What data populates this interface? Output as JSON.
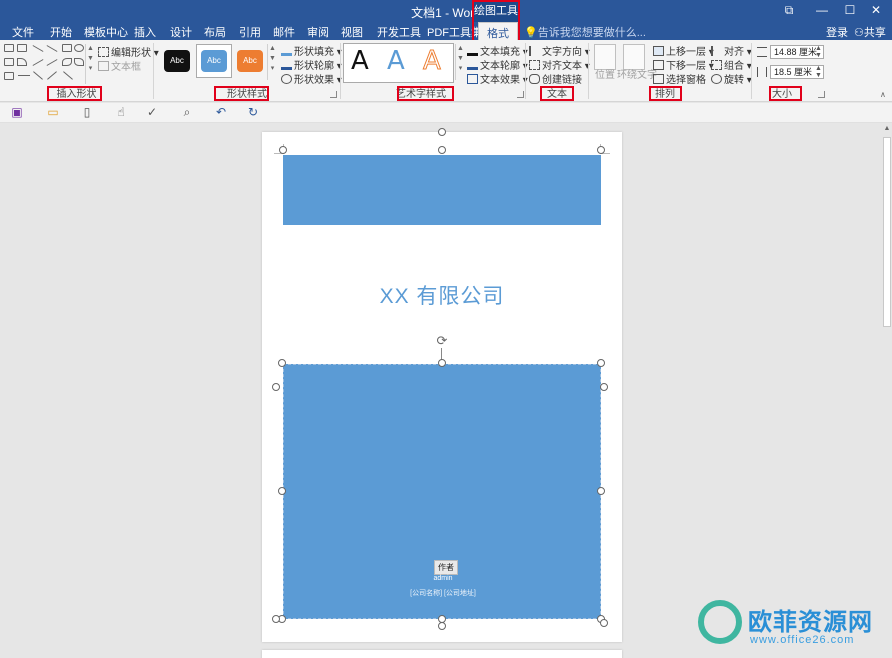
{
  "titlebar": {
    "title": "文档1 - Word",
    "context_label": "绘图工具",
    "buttons": [
      "⧉",
      "—",
      "☐",
      "✕"
    ]
  },
  "tabs": {
    "items": [
      "文件",
      "开始",
      "模板中心",
      "插入",
      "设计",
      "布局",
      "引用",
      "邮件",
      "审阅",
      "视图",
      "开发工具",
      "PDF工具集"
    ],
    "active": "格式",
    "tell_me": "告诉我您想要做什么...",
    "login": "登录",
    "share": "共享"
  },
  "ribbon": {
    "insert_shapes": {
      "label": "插入形状",
      "edit_shape": "编辑形状",
      "text_box": "文本框"
    },
    "shape_styles": {
      "label": "形状样式",
      "presets": [
        "Abc",
        "Abc",
        "Abc"
      ],
      "fill": "形状填充",
      "outline": "形状轮廓",
      "effects": "形状效果"
    },
    "wordart": {
      "label": "艺术字样式",
      "samples": [
        "A",
        "A",
        "A"
      ],
      "text_fill": "文本填充",
      "text_outline": "文本轮廓",
      "text_effects": "文本效果"
    },
    "text": {
      "label": "文本",
      "direction": "文字方向",
      "align": "对齐文本",
      "link": "创建链接"
    },
    "arrange": {
      "label": "排列",
      "position": "位置",
      "wrap": "环绕文字",
      "forward": "上移一层",
      "backward": "下移一层",
      "selection_pane": "选择窗格",
      "align": "对齐",
      "group": "组合",
      "rotate": "旋转"
    },
    "size": {
      "label": "大小",
      "height": "14.88 厘米",
      "width": "18.5 厘米"
    }
  },
  "document": {
    "company": "XX 有限公司",
    "author_tag": "作者",
    "author": "admin",
    "address": "[公司名称] [公司地址]"
  },
  "watermark": {
    "brand": "欧菲资源网",
    "url": "www.office26.com"
  },
  "colors": {
    "accent": "#2b579a",
    "shape_blue": "#5b9bd5",
    "highlight_red": "#e1001a"
  }
}
